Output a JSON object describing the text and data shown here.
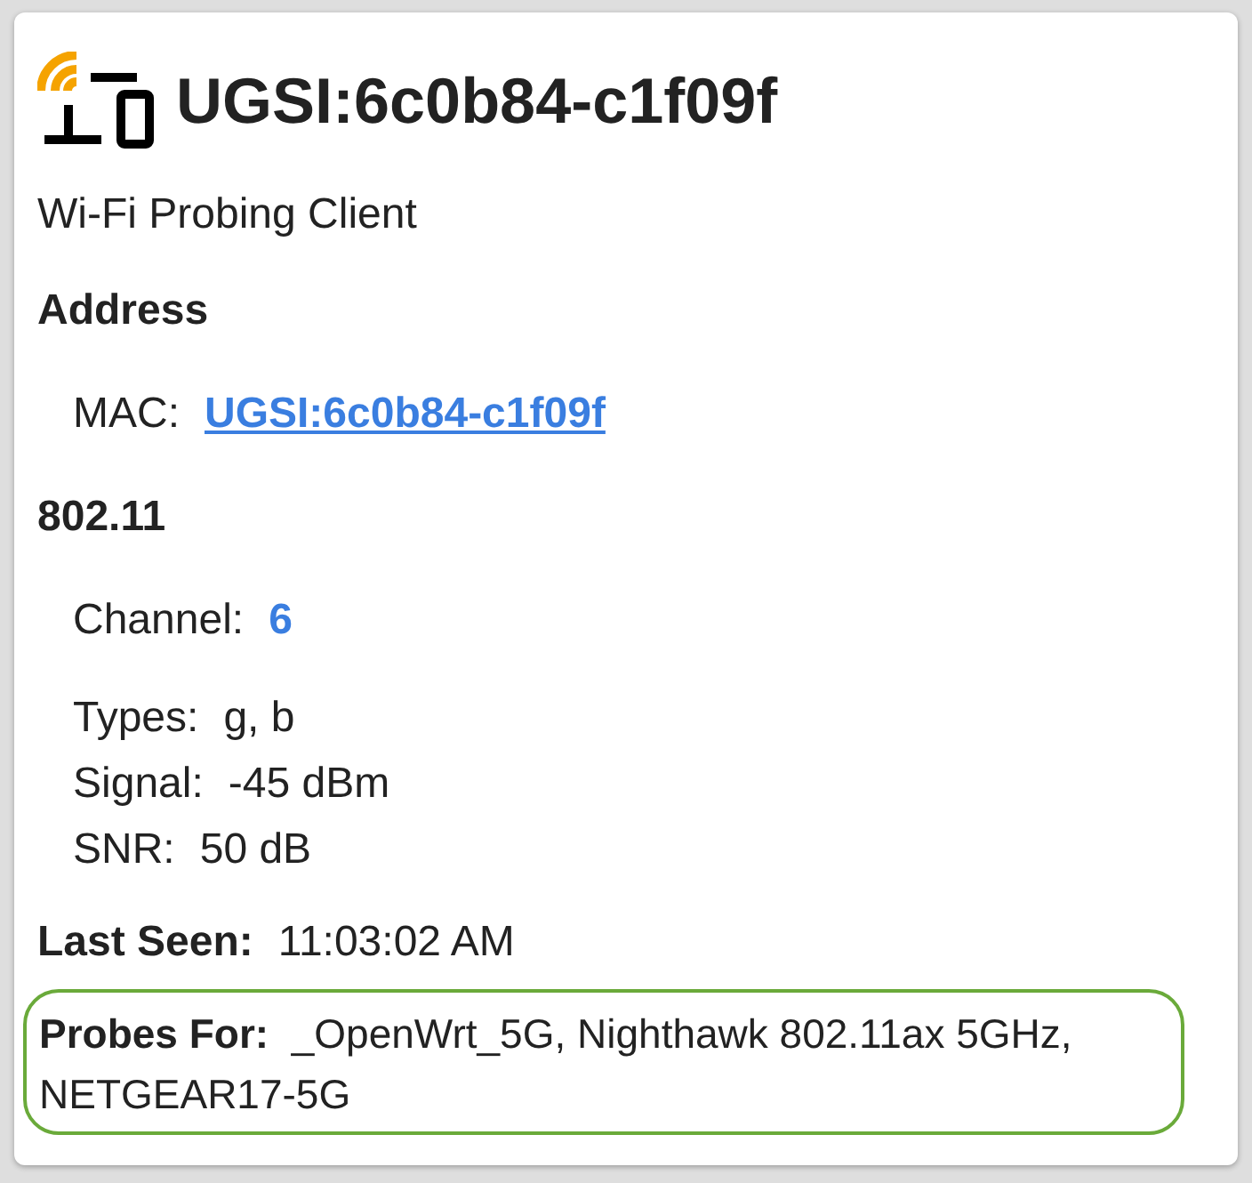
{
  "title": "UGSI:6c0b84-c1f09f",
  "subtitle": "Wi-Fi Probing Client",
  "sections": [
    {
      "heading": "Address",
      "groups": [
        [
          {
            "label": "MAC:",
            "value": "UGSI:6c0b84-c1f09f",
            "kind": "link"
          }
        ]
      ]
    },
    {
      "heading": "802.11",
      "groups": [
        [
          {
            "label": "Channel:",
            "value": "6",
            "kind": "accent"
          }
        ],
        [
          {
            "label": "Types:",
            "value": "g, b",
            "kind": "plain"
          },
          {
            "label": "Signal:",
            "value": "-45 dBm",
            "kind": "plain"
          },
          {
            "label": "SNR:",
            "value": "50 dB",
            "kind": "plain"
          }
        ]
      ]
    }
  ],
  "last_seen": {
    "label": "Last Seen:",
    "value": "11:03:02 AM"
  },
  "probes": {
    "label": "Probes For:",
    "value": "_OpenWrt_5G, Nighthawk 802.11ax 5GHz, NETGEAR17-5G",
    "highlighted": true
  }
}
